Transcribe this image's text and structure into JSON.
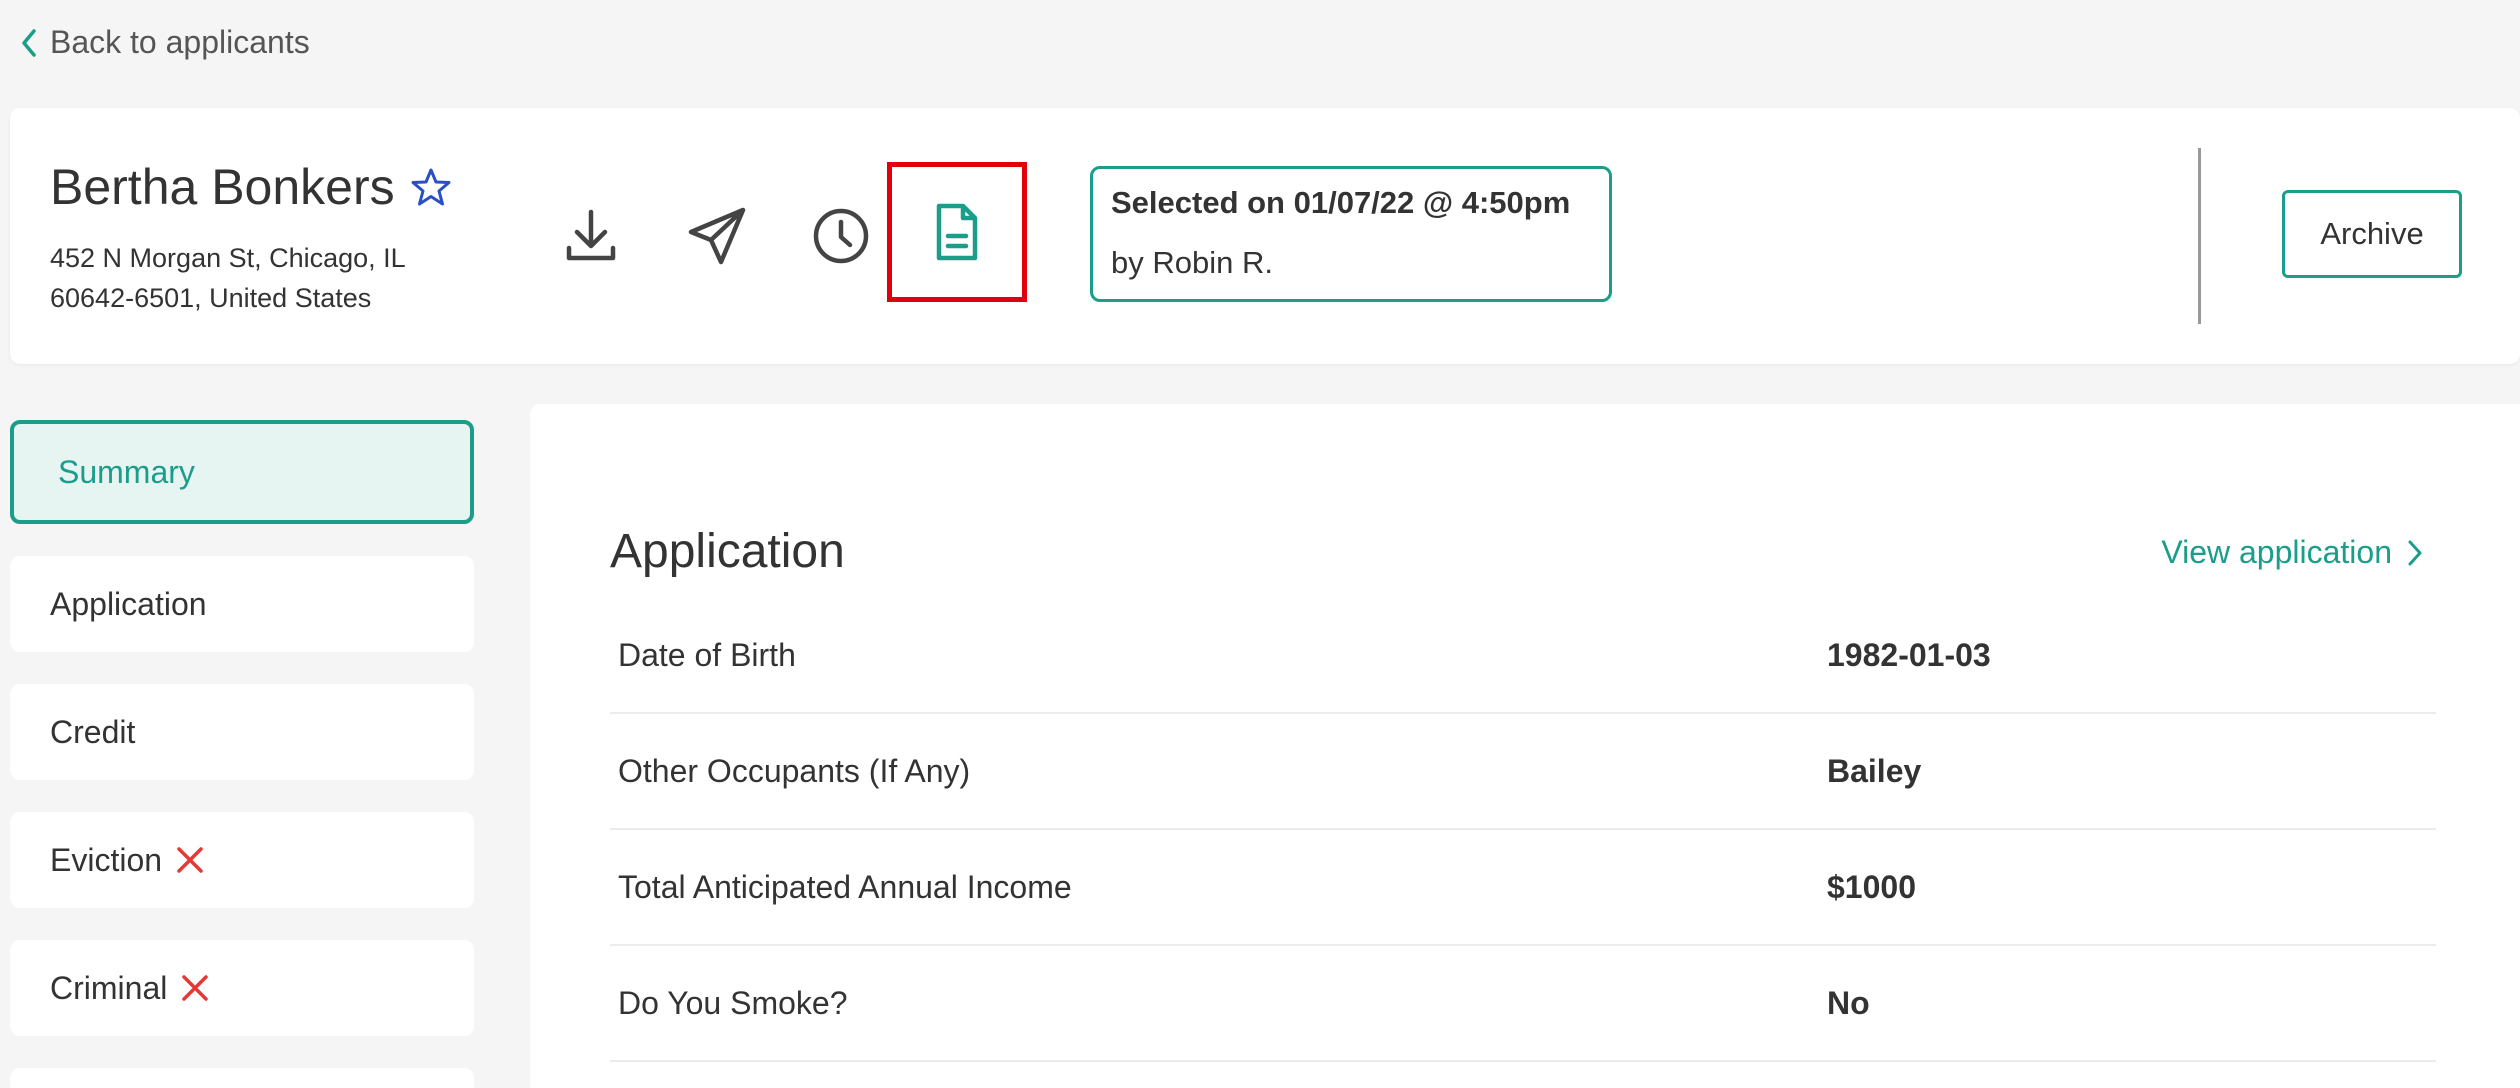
{
  "nav": {
    "back_label": "Back to applicants"
  },
  "applicant": {
    "name": "Bertha Bonkers",
    "address_line1": "452 N Morgan St, Chicago, IL",
    "address_line2": "60642-6501, United States"
  },
  "actions": [
    {
      "icon": "download-icon"
    },
    {
      "icon": "send-icon"
    },
    {
      "icon": "history-icon"
    },
    {
      "icon": "document-icon",
      "highlighted": true
    }
  ],
  "selection": {
    "line1": "Selected on 01/07/22 @ 4:50pm",
    "line2": "by Robin R."
  },
  "archive_label": "Archive",
  "sidebar": {
    "items": [
      {
        "label": "Summary",
        "active": true
      },
      {
        "label": "Application"
      },
      {
        "label": "Credit"
      },
      {
        "label": "Eviction",
        "flag": "x-icon"
      },
      {
        "label": "Criminal",
        "flag": "x-icon"
      }
    ]
  },
  "main": {
    "title": "Application",
    "view_link": "View application",
    "fields": [
      {
        "label": "Date of Birth",
        "value": "1982-01-03"
      },
      {
        "label": "Other Occupants (If Any)",
        "value": "Bailey"
      },
      {
        "label": "Total Anticipated Annual Income",
        "value": "$1000"
      },
      {
        "label": "Do You Smoke?",
        "value": "No"
      }
    ]
  },
  "colors": {
    "accent": "#1a9e8a",
    "danger": "#e0000d",
    "star": "#2b4fc4"
  }
}
